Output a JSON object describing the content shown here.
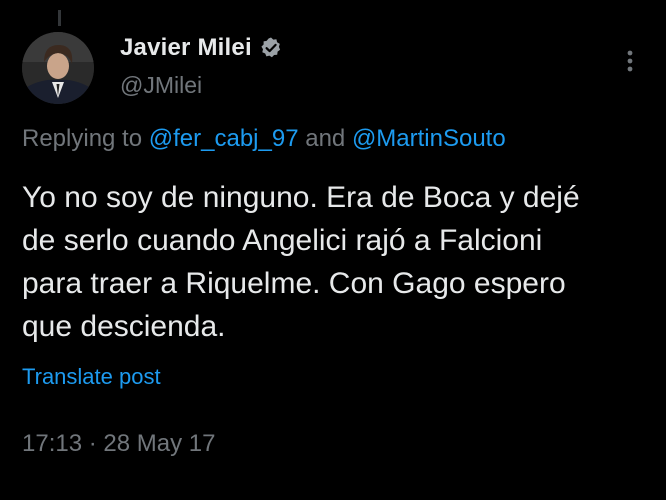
{
  "author": {
    "display_name": "Javier Milei",
    "handle": "@JMilei",
    "verified_icon": "verified-badge-icon",
    "avatar_icon": "avatar"
  },
  "reply": {
    "prefix": "Replying to ",
    "mention1": "@fer_cabj_97",
    "conjunction": " and ",
    "mention2": "@MartinSouto"
  },
  "tweet": {
    "lines": [
      "Yo no soy de ninguno. Era de Boca y dejé",
      "de serlo cuando Angelici rajó a Falcioni",
      "para traer a Riquelme. Con Gago espero",
      "que descienda."
    ]
  },
  "translate_label": "Translate post",
  "meta": {
    "time": "17:13",
    "separator": " · ",
    "date": "28 May 17"
  },
  "colors": {
    "background": "#000000",
    "text": "#e7e9ea",
    "muted": "#71767b",
    "accent": "#1d9bf0"
  }
}
